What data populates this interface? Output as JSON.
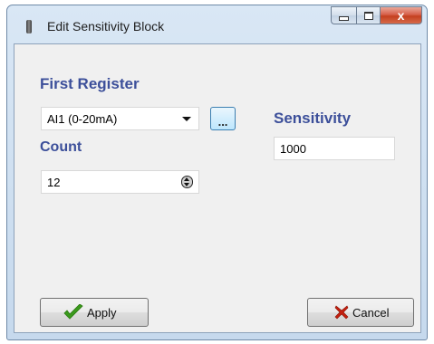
{
  "window": {
    "title": "Edit Sensitivity Block",
    "controls": {
      "minimize": "minimize",
      "maximize": "maximize",
      "close": "x"
    }
  },
  "first_register": {
    "label": "First Register",
    "selected_value": "AI1 (0-20mA)",
    "browse_label": "..."
  },
  "count": {
    "label": "Count",
    "value": "12"
  },
  "sensitivity": {
    "label": "Sensitivity",
    "value": "1000"
  },
  "buttons": {
    "apply": "Apply",
    "cancel": "Cancel"
  },
  "icons": {
    "apply": "checkmark-icon",
    "cancel": "x-icon",
    "app": "app-icon"
  },
  "colors": {
    "label_text": "#3c4f9a",
    "apply_check": "#3a9a1c",
    "cancel_x": "#c42010",
    "close_button": "#c4401f"
  }
}
